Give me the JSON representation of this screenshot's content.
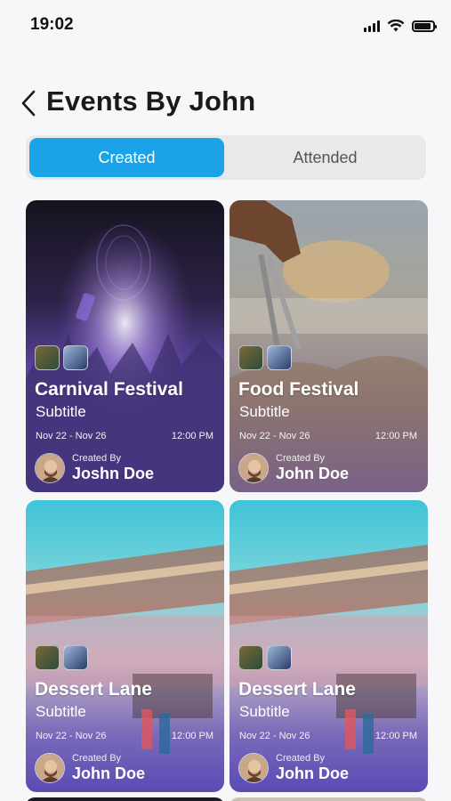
{
  "status_bar": {
    "time": "19:02"
  },
  "header": {
    "title": "Events By John"
  },
  "tabs": [
    {
      "label": "Created",
      "active": true
    },
    {
      "label": "Attended",
      "active": false
    }
  ],
  "cards": [
    {
      "title": "Carnival Festival",
      "subtitle": "Subtitle",
      "date_range": "Nov 22 - Nov 26",
      "time": "12:00 PM",
      "created_by_label": "Created By",
      "creator_name": "Joshn Doe"
    },
    {
      "title": "Food Festival",
      "subtitle": "Subtitle",
      "date_range": "Nov 22 - Nov 26",
      "time": "12:00 PM",
      "created_by_label": "Created By",
      "creator_name": "John Doe"
    },
    {
      "title": "Dessert Lane",
      "subtitle": "Subtitle",
      "date_range": "Nov 22 - Nov 26",
      "time": "12:00 PM",
      "created_by_label": "Created By",
      "creator_name": "John Doe"
    },
    {
      "title": "Dessert Lane",
      "subtitle": "Subtitle",
      "date_range": "Nov 22 - Nov 26",
      "time": "12:00 PM",
      "created_by_label": "Created By",
      "creator_name": "John Doe"
    }
  ],
  "colors": {
    "accent": "#1aa3e8",
    "card_overlay": "#5b4bb5"
  }
}
